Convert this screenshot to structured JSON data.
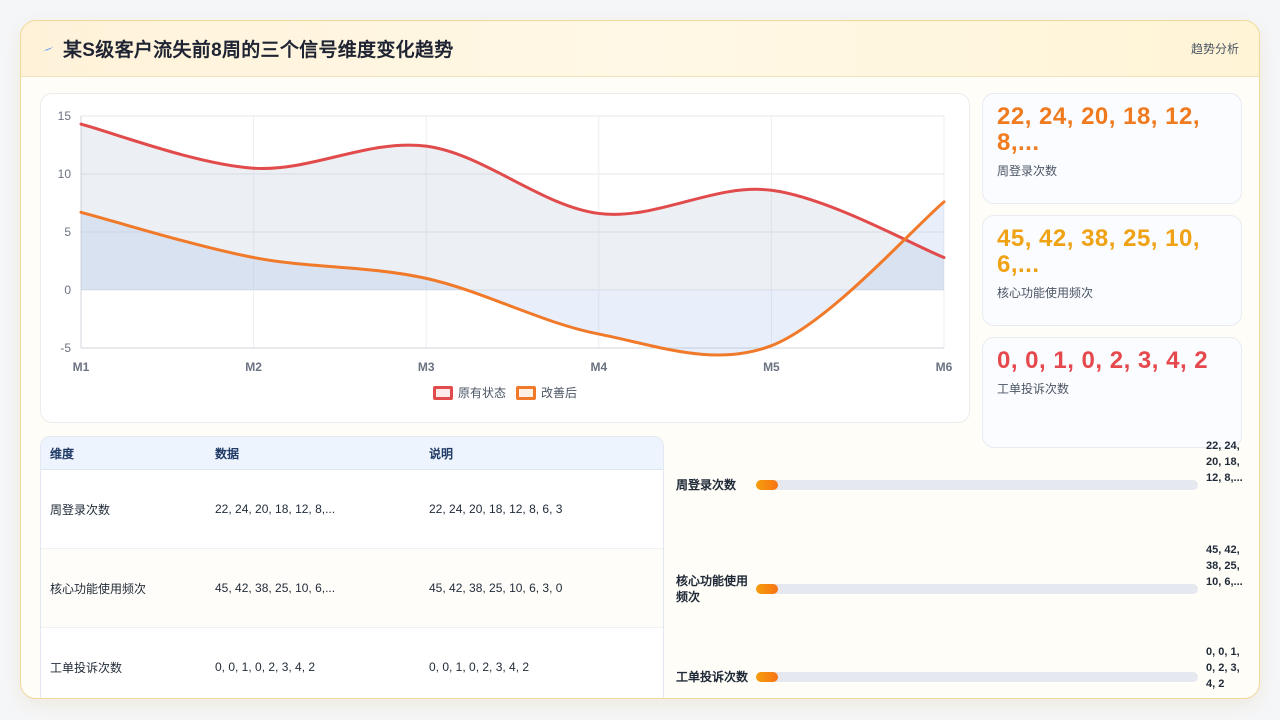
{
  "header": {
    "title": "某S级客户流失前8周的三个信号维度变化趋势",
    "link": "趋势分析",
    "icon": "lightning-icon"
  },
  "colors": {
    "series_original": "#e24b4b",
    "series_improved": "#f07a2a",
    "stat_1": "#f07a1e",
    "stat_2": "#f0a215",
    "stat_3": "#e5484d"
  },
  "chart_data": {
    "type": "line",
    "x": [
      "M1",
      "M2",
      "M3",
      "M4",
      "M5",
      "M6"
    ],
    "ylim": [
      -5,
      15
    ],
    "yticks": [
      15,
      10,
      5,
      0,
      -5
    ],
    "grid": true,
    "legend_position": "bottom",
    "series": [
      {
        "name": "原有状态",
        "values": [
          14.3,
          10.5,
          12.4,
          6.6,
          8.6,
          2.8
        ],
        "color": "#e24b4b"
      },
      {
        "name": "改善后",
        "values": [
          6.7,
          2.8,
          1.0,
          -3.8,
          -4.8,
          7.6
        ],
        "color": "#f07a2a"
      }
    ]
  },
  "stats": [
    {
      "value": "22, 24, 20, 18, 12, 8,...",
      "label": "周登录次数"
    },
    {
      "value": "45, 42, 38, 25, 10, 6,...",
      "label": "核心功能使用频次"
    },
    {
      "value": "0, 0, 1, 0, 2, 3, 4, 2",
      "label": "工单投诉次数"
    }
  ],
  "table": {
    "headers": [
      "维度",
      "数据",
      "说明"
    ],
    "rows": [
      [
        "周登录次数",
        "22, 24, 20, 18, 12, 8,...",
        "22, 24, 20, 18, 12, 8, 6, 3"
      ],
      [
        "核心功能使用频次",
        "45, 42, 38, 25, 10, 6,...",
        "45, 42, 38, 25, 10, 6, 3, 0"
      ],
      [
        "工单投诉次数",
        "0, 0, 1, 0, 2, 3, 4, 2",
        "0, 0, 1, 0, 2, 3, 4, 2"
      ]
    ]
  },
  "bars": [
    {
      "label": "周登录次数",
      "value": "22, 24, 20, 18, 12, 8,...",
      "fill": 0.05
    },
    {
      "label": "核心功能使用频次",
      "value": "45, 42, 38, 25, 10, 6,...",
      "fill": 0.05
    },
    {
      "label": "工单投诉次数",
      "value": "0, 0, 1, 0, 2, 3, 4, 2",
      "fill": 0.05
    }
  ]
}
